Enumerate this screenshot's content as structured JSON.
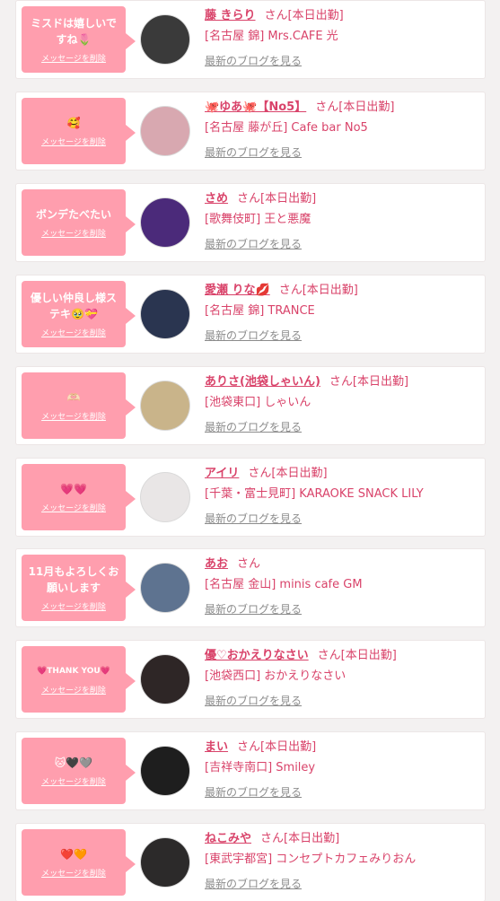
{
  "ui": {
    "delete_label": "メッセージを削除",
    "blog_label": "最新のブログを見る",
    "san_label": "さん",
    "pink": "#ff9eae",
    "accent": "#d9436a"
  },
  "items": [
    {
      "message": "ミスドは嬉しいですね🌷",
      "name": "藤 きらり",
      "status": "[本日出勤]",
      "shop": "[名古屋 錦] Mrs.CAFE 光",
      "avatar_color": "#3a3a3a"
    },
    {
      "message": "🥰",
      "name": "🐙ゆあ🐙【No5】",
      "status": "[本日出勤]",
      "shop": "[名古屋 藤が丘] Cafe bar No5",
      "avatar_color": "#d8a8b0"
    },
    {
      "message": "ボンデたべたい",
      "name": "さめ",
      "status": "[本日出勤]",
      "shop": "[歌舞伎町] 王と悪魔",
      "avatar_color": "#4b2a7a"
    },
    {
      "message": "優しい仲良し様ステキ🥹💝",
      "name": "愛瀬 りな💋",
      "status": "[本日出勤]",
      "shop": "[名古屋 錦] TRANCE",
      "avatar_color": "#2a3550"
    },
    {
      "message": "🫶🏻",
      "name": "ありさ(池袋しゃいん)",
      "status": "[本日出勤]",
      "shop": "[池袋東口] しゃいん",
      "avatar_color": "#c9b48a"
    },
    {
      "message": "💗💗",
      "name": "アイリ",
      "status": "[本日出勤]",
      "shop": "[千葉・富士見町] KARAOKE SNACK LILY",
      "avatar_color": "#e9e6e6"
    },
    {
      "message": "11月もよろしくお願いします",
      "name": "あお",
      "status": "",
      "shop": "[名古屋 金山] minis cafe GM",
      "avatar_color": "#5e7390"
    },
    {
      "message": "💗THANK YOU💗",
      "name": "優♡おかえりなさい",
      "status": "[本日出勤]",
      "shop": "[池袋西口] おかえりなさい",
      "avatar_color": "#2e2626",
      "small": true
    },
    {
      "message": "🐱🖤🩶",
      "name": "まい",
      "status": "[本日出勤]",
      "shop": "[吉祥寺南口] Smiley",
      "avatar_color": "#1e1e1e"
    },
    {
      "message": "❤️🧡",
      "name": "ねこみや",
      "status": "[本日出勤]",
      "shop": "[東武宇都宮] コンセプトカフェみりおん",
      "avatar_color": "#2c2a2a"
    }
  ]
}
